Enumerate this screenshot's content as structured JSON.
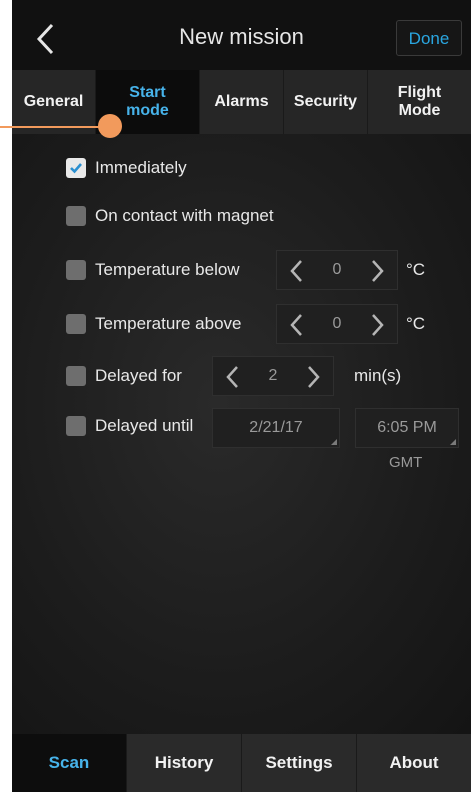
{
  "header": {
    "title": "New mission",
    "done_label": "Done"
  },
  "tabs": [
    {
      "label": "General"
    },
    {
      "label": "Start mode",
      "active": true
    },
    {
      "label": "Alarms"
    },
    {
      "label": "Security"
    },
    {
      "label": "Flight Mode"
    }
  ],
  "options": {
    "immediately": {
      "label": "Immediately",
      "checked": true
    },
    "magnet": {
      "label": "On contact with magnet",
      "checked": false
    },
    "temp_below": {
      "label": "Temperature below",
      "checked": false,
      "value": "0",
      "unit": "°C"
    },
    "temp_above": {
      "label": "Temperature above",
      "checked": false,
      "value": "0",
      "unit": "°C"
    },
    "delayed_for": {
      "label": "Delayed for",
      "checked": false,
      "value": "2",
      "unit": "min(s)"
    },
    "delayed_until": {
      "label": "Delayed until",
      "checked": false,
      "date": "2/21/17",
      "time": "6:05 PM",
      "timezone": "GMT"
    }
  },
  "navbar": [
    {
      "label": "Scan",
      "active": true
    },
    {
      "label": "History"
    },
    {
      "label": "Settings"
    },
    {
      "label": "About"
    }
  ],
  "colors": {
    "accent": "#47b3ea",
    "callout": "#f29a5c",
    "background": "#1a1a1a"
  },
  "icons": {
    "back": "chevron-left-icon",
    "decrement": "chevron-left-icon",
    "increment": "chevron-right-icon",
    "check": "checkmark-icon"
  }
}
